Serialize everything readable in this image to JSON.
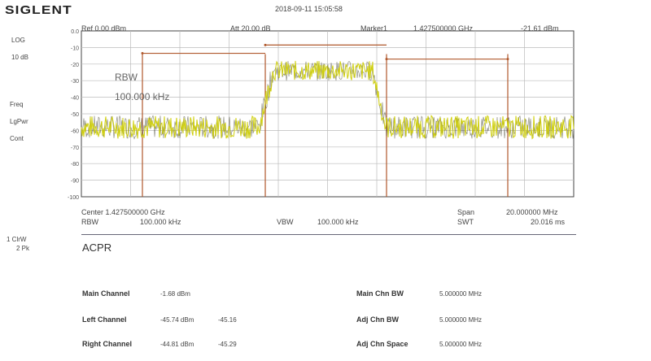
{
  "header": {
    "logo": "SIGLENT",
    "datetime": "2018-09-11  15:05:58"
  },
  "top_bar": {
    "ref": "Ref  0.00 dBm",
    "att": "Att  20.00 dB",
    "marker": "Marker1",
    "marker_freq": "1.427500000  GHz",
    "marker_level": "-21.61 dBm"
  },
  "left_panel": {
    "scale_type": "LOG",
    "scale_div": "10 dB",
    "mode": "Freq",
    "power": "LgPwr",
    "cont": "Cont",
    "trace_label": "1 ClrW",
    "trace_mode": "2 Pk"
  },
  "chart_data": {
    "type": "line",
    "title": "",
    "y_ticks": [
      "0.0",
      "-10",
      "-20",
      "-30",
      "-40",
      "-50",
      "-60",
      "-70",
      "-80",
      "-90",
      "-100"
    ],
    "ylim": [
      -100,
      0
    ],
    "x_center_ghz": 1.4275,
    "x_span_mhz": 20,
    "grid": true,
    "noise_floor_dbm": -58,
    "main_channel_level_dbm": -24,
    "annotations": {
      "rbw_label": "RBW",
      "rbw_value": "100.000 kHz"
    }
  },
  "bottom_bar": {
    "center": "Center  1.427500000  GHz",
    "span": "Span",
    "span_value": "20.000000  MHz",
    "rbw": "RBW",
    "rbw_value": "100.000  kHz",
    "vbw": "VBW",
    "vbw_value": "100.000  kHz",
    "swt": "SWT",
    "swt_value": "20.016  ms"
  },
  "acpr": {
    "title": "ACPR",
    "rows": [
      {
        "label": "Main Channel",
        "value": "-1.68  dBm",
        "ratio": ""
      },
      {
        "label": "Left Channel",
        "value": "-45.74  dBm",
        "ratio": "-45.16"
      },
      {
        "label": "Right Channel",
        "value": "-44.81  dBm",
        "ratio": "-45.29"
      }
    ],
    "params": [
      {
        "label": "Main Chn BW",
        "value": "5.000000  MHz"
      },
      {
        "label": "Adj Chn BW",
        "value": "5.000000  MHz"
      },
      {
        "label": "Adj Chn Space",
        "value": "5.000000  MHz"
      }
    ]
  },
  "colors": {
    "trace": "#cfcf10",
    "trace_dark": "#2a2a10",
    "channel_marker": "#b0582c",
    "grid": "#bbbbbb"
  }
}
